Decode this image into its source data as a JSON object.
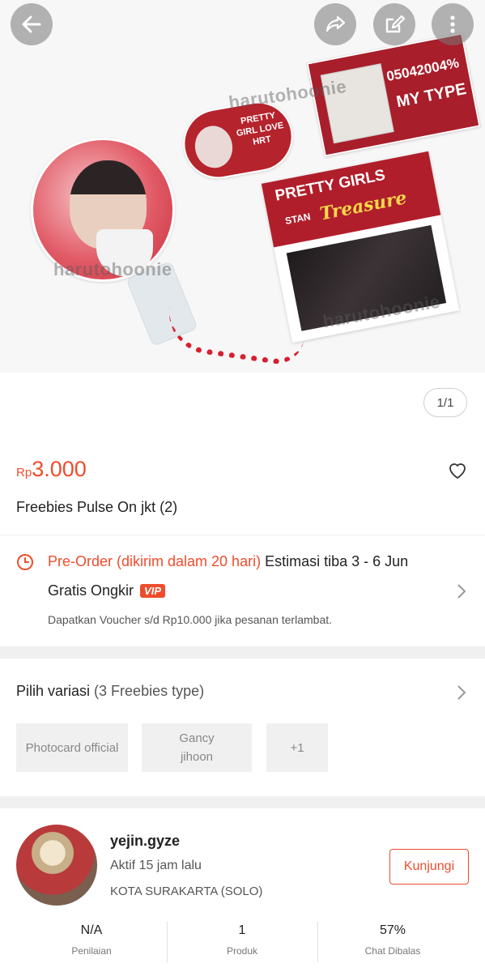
{
  "hero": {
    "watermark": "harutohoonie",
    "pill_text": "PRETTY GIRL LOVE HRT",
    "card1_line1": "05042004%",
    "card1_line2": "MY TYPE",
    "card2_line1": "PRETTY GIRLS",
    "card2_line2": "STAN",
    "card2_line3": "Treasure",
    "pager": "1/1"
  },
  "icons": {
    "back": "arrow-left-icon",
    "share": "share-icon",
    "edit": "edit-icon",
    "more": "more-vertical-icon",
    "favorite": "heart-icon",
    "clock": "clock-icon",
    "chevron": "chevron-right-icon"
  },
  "product": {
    "currency": "Rp",
    "price": "3.000",
    "name": "Freebies Pulse On jkt  (2)"
  },
  "shipping": {
    "preorder": "Pre-Order (dikirim dalam 20 hari)",
    "estimate": "Estimasi tiba 3 - 6 Jun",
    "free_shipping": "Gratis Ongkir",
    "vip_badge": "VIP",
    "voucher_note": "Dapatkan Voucher s/d Rp10.000 jika pesanan terlambat."
  },
  "variation": {
    "title": "Pilih variasi",
    "count": "(3 Freebies type)",
    "options": [
      "Photocard official",
      "Gancy jihoon",
      "+1"
    ]
  },
  "shop": {
    "name": "yejin.gyze",
    "active": "Aktif 15 jam lalu",
    "location": "KOTA SURAKARTA (SOLO)",
    "visit_button": "Kunjungi",
    "stats": [
      {
        "value": "N/A",
        "label": "Penilaian"
      },
      {
        "value": "1",
        "label": "Produk"
      },
      {
        "value": "57%",
        "label": "Chat Dibalas"
      }
    ]
  },
  "colors": {
    "accent": "#ee4d2d",
    "background": "#f0f0f0"
  }
}
